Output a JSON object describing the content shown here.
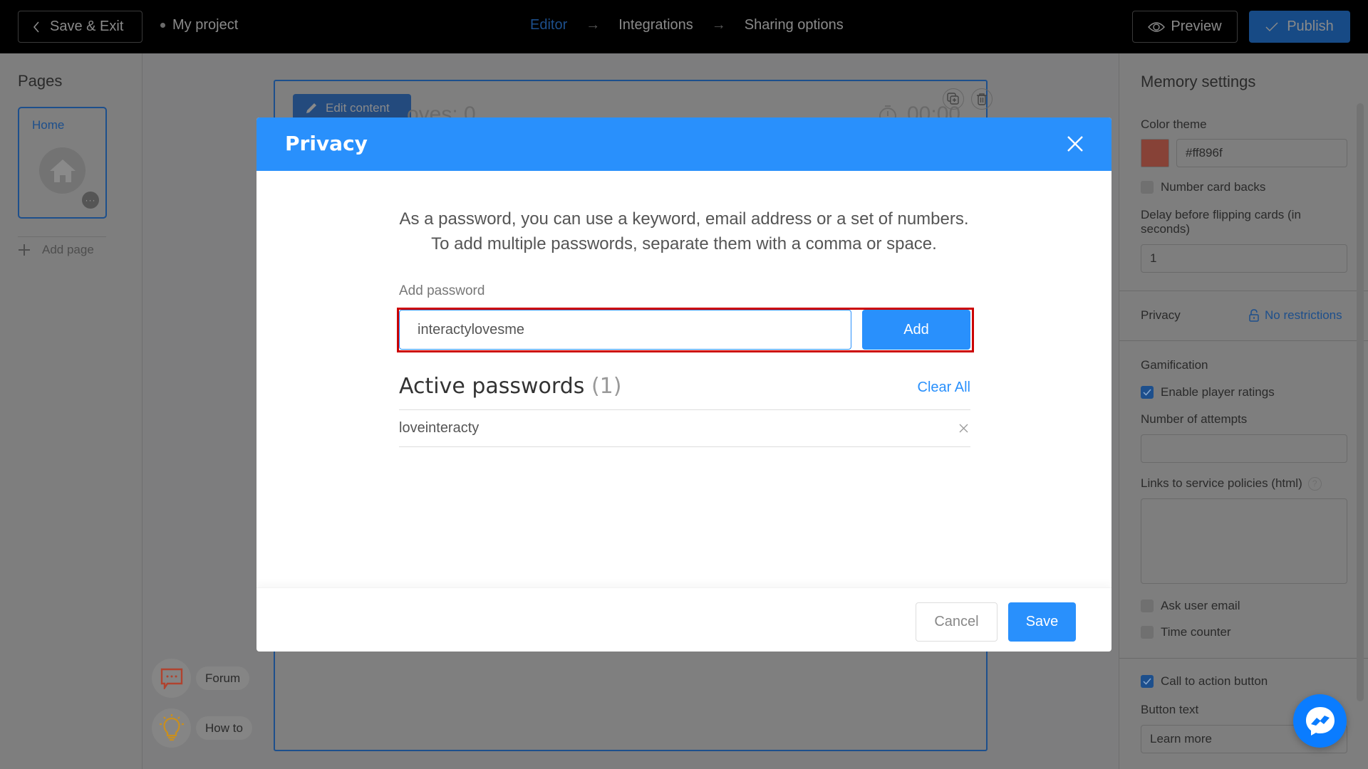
{
  "topbar": {
    "save_exit_label": "Save & Exit",
    "project_name": "My project",
    "steps": [
      {
        "label": "Editor",
        "active": true
      },
      {
        "label": "Integrations",
        "active": false
      },
      {
        "label": "Sharing options",
        "active": false
      }
    ],
    "preview_label": "Preview",
    "publish_label": "Publish"
  },
  "left_sidebar": {
    "title": "Pages",
    "pages": [
      {
        "label": "Home"
      }
    ],
    "add_page_label": "Add page"
  },
  "canvas": {
    "edit_content_label": "Edit content",
    "moves_text": "oves: 0",
    "timer_text": "00:00"
  },
  "help": {
    "forum_label": "Forum",
    "howto_label": "How to"
  },
  "right_panel": {
    "title": "Memory settings",
    "color_theme_label": "Color theme",
    "color_theme_value": "#ff896f",
    "color_swatch": "#ff896f",
    "number_card_backs_label": "Number card backs",
    "number_card_backs_checked": false,
    "delay_label": "Delay before flipping cards (in seconds)",
    "delay_value": "1",
    "privacy_label": "Privacy",
    "privacy_value": "No restrictions",
    "gamification_label": "Gamification",
    "enable_ratings_label": "Enable player ratings",
    "enable_ratings_checked": true,
    "attempts_label": "Number of attempts",
    "attempts_value": "",
    "policies_label": "Links to service policies (html)",
    "policies_value": "",
    "ask_email_label": "Ask user email",
    "ask_email_checked": false,
    "time_counter_label": "Time counter",
    "time_counter_checked": false,
    "cta_label": "Call to action button",
    "cta_checked": true,
    "button_text_label": "Button text",
    "button_text_value": "Learn more"
  },
  "modal": {
    "title": "Privacy",
    "description_line1": "As a password, you can use a keyword, email address or a set of numbers.",
    "description_line2": "To add multiple passwords, separate them with a comma or space.",
    "add_password_label": "Add password",
    "password_input_value": "interactylovesme",
    "add_button_label": "Add",
    "active_passwords_label": "Active passwords",
    "active_passwords_count": "(1)",
    "clear_all_label": "Clear All",
    "passwords": [
      "loveinteracty"
    ],
    "cancel_label": "Cancel",
    "save_label": "Save"
  },
  "colors": {
    "accent": "#2990fc",
    "highlight_box": "#cc0000",
    "topbar_bg": "#000000",
    "overlay": "#7d7d7e",
    "messenger": "#0a7cff"
  }
}
